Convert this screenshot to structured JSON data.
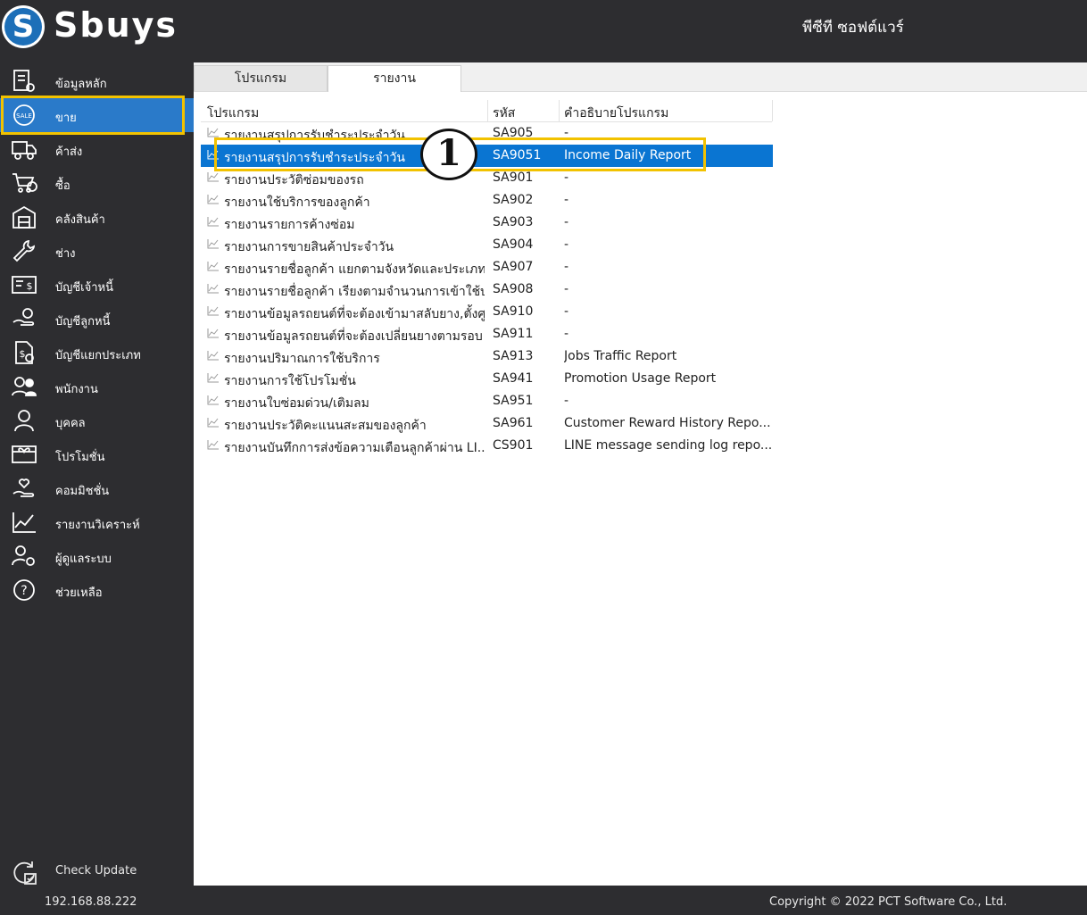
{
  "app": {
    "logo_text": "Sbuys",
    "company": "พีซีที ซอฟต์แวร์"
  },
  "sidebar": {
    "items": [
      {
        "label": "ข้อมูลหลัก",
        "icon": "master-data-icon"
      },
      {
        "label": "ขาย",
        "icon": "sale-badge-icon"
      },
      {
        "label": "ค้าส่ง",
        "icon": "delivery-truck-icon"
      },
      {
        "label": "ซื้อ",
        "icon": "shopping-cart-icon"
      },
      {
        "label": "คลังสินค้า",
        "icon": "warehouse-icon"
      },
      {
        "label": "ช่าง",
        "icon": "mechanic-wrench-icon"
      },
      {
        "label": "บัญชีเจ้าหนี้",
        "icon": "payable-bill-icon"
      },
      {
        "label": "บัญชีลูกหนี้",
        "icon": "receivable-hand-icon"
      },
      {
        "label": "บัญชีแยกประเภท",
        "icon": "ledger-document-icon"
      },
      {
        "label": "พนักงาน",
        "icon": "employees-icon"
      },
      {
        "label": "บุคคล",
        "icon": "person-icon"
      },
      {
        "label": "โปรโมชั่น",
        "icon": "promotion-ticket-icon"
      },
      {
        "label": "คอมมิชชั่น",
        "icon": "commission-hand-icon"
      },
      {
        "label": "รายงานวิเคราะห์",
        "icon": "analysis-chart-icon"
      },
      {
        "label": "ผู้ดูแลระบบ",
        "icon": "admin-user-gear-icon"
      },
      {
        "label": "ช่วยเหลือ",
        "icon": "help-icon"
      }
    ],
    "active_index": 1,
    "check_update": "Check Update"
  },
  "tabs": [
    {
      "label": "โปรแกรม"
    },
    {
      "label": "รายงาน"
    }
  ],
  "grid": {
    "headers": [
      "โปรแกรม",
      "รหัส",
      "คำอธิบายโปรแกรม"
    ],
    "rows": [
      {
        "name": "รายงานสรุปการรับชำระประจำวัน",
        "code": "SA905",
        "desc": "-"
      },
      {
        "name": "รายงานสรุปการรับชำระประจำวัน",
        "code": "SA9051",
        "desc": "Income Daily Report"
      },
      {
        "name": "รายงานประวัติซ่อมของรถ",
        "code": "SA901",
        "desc": "-"
      },
      {
        "name": "รายงานใช้บริการของลูกค้า",
        "code": "SA902",
        "desc": "-"
      },
      {
        "name": "รายงานรายการค้างซ่อม",
        "code": "SA903",
        "desc": "-"
      },
      {
        "name": "รายงานการขายสินค้าประจำวัน",
        "code": "SA904",
        "desc": "-"
      },
      {
        "name": "รายงานรายชื่อลูกค้า แยกตามจังหวัดและประเภท...",
        "code": "SA907",
        "desc": "-"
      },
      {
        "name": "รายงานรายชื่อลูกค้า เรียงตามจำนวนการเข้าใช้บ...",
        "code": "SA908",
        "desc": "-"
      },
      {
        "name": "รายงานข้อมูลรถยนต์ที่จะต้องเข้ามาสลับยาง,ตั้งศู...",
        "code": "SA910",
        "desc": "-"
      },
      {
        "name": "รายงานข้อมูลรถยนต์ที่จะต้องเปลี่ยนยางตามรอบ",
        "code": "SA911",
        "desc": "-"
      },
      {
        "name": "รายงานปริมาณการใช้บริการ",
        "code": "SA913",
        "desc": "Jobs Traffic Report"
      },
      {
        "name": "รายงานการใช้โปรโมชั่น",
        "code": "SA941",
        "desc": "Promotion Usage Report"
      },
      {
        "name": "รายงานใบซ่อมด่วน/เติมลม",
        "code": "SA951",
        "desc": "-"
      },
      {
        "name": "รายงานประวัติคะแนนสะสมของลูกค้า",
        "code": "SA961",
        "desc": "Customer Reward History Repo..."
      },
      {
        "name": "รายงานบันทึกการส่งข้อความเตือนลูกค้าผ่าน LI...",
        "code": "CS901",
        "desc": "LINE message sending log repo..."
      }
    ],
    "selected_index": 1
  },
  "callout": {
    "number": "1"
  },
  "status": {
    "ip": "192.168.88.222",
    "copyright": "Copyright © 2022 PCT Software Co., Ltd."
  },
  "colors": {
    "accent": "#0a75d2",
    "highlight": "#f2c200",
    "sidebar_bg": "#2d2d30"
  }
}
